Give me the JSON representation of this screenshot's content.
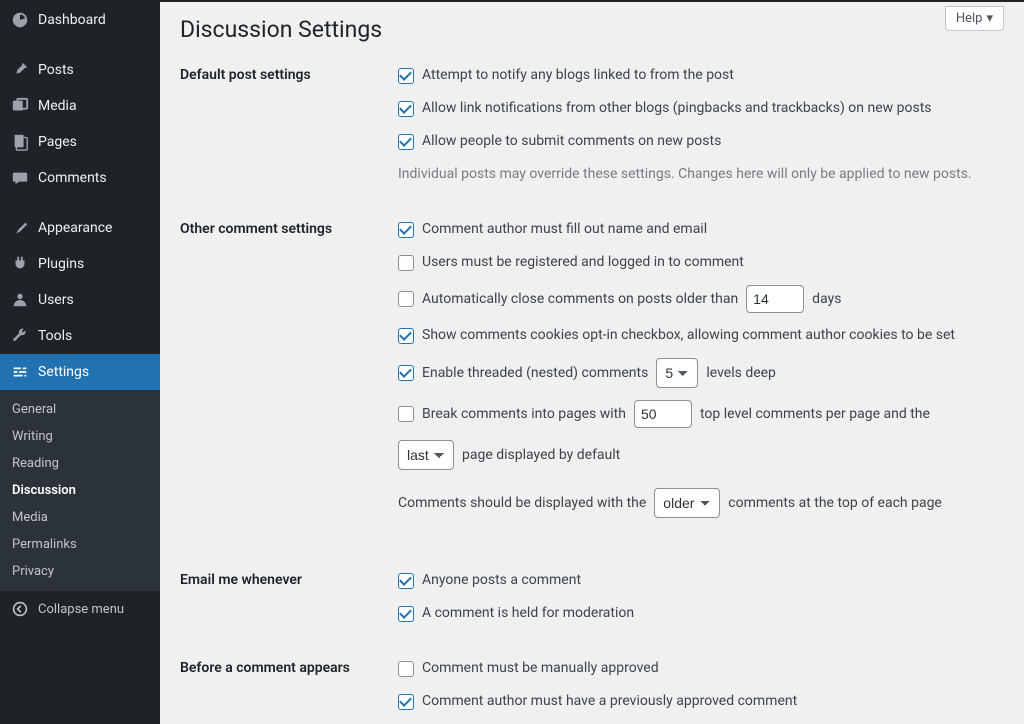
{
  "help_label": "Help",
  "page_title": "Discussion Settings",
  "sidebar": {
    "items": [
      {
        "label": "Dashboard",
        "icon": "dashboard"
      },
      {
        "label": "Posts",
        "icon": "pin"
      },
      {
        "label": "Media",
        "icon": "media"
      },
      {
        "label": "Pages",
        "icon": "page"
      },
      {
        "label": "Comments",
        "icon": "comment"
      },
      {
        "label": "Appearance",
        "icon": "brush"
      },
      {
        "label": "Plugins",
        "icon": "plug"
      },
      {
        "label": "Users",
        "icon": "user"
      },
      {
        "label": "Tools",
        "icon": "wrench"
      },
      {
        "label": "Settings",
        "icon": "sliders"
      }
    ],
    "submenu": [
      "General",
      "Writing",
      "Reading",
      "Discussion",
      "Media",
      "Permalinks",
      "Privacy"
    ],
    "submenu_active": "Discussion",
    "collapse_label": "Collapse menu"
  },
  "sections": {
    "default_post": {
      "heading": "Default post settings",
      "items": [
        {
          "checked": true,
          "label": "Attempt to notify any blogs linked to from the post"
        },
        {
          "checked": true,
          "label": "Allow link notifications from other blogs (pingbacks and trackbacks) on new posts"
        },
        {
          "checked": true,
          "label": "Allow people to submit comments on new posts"
        }
      ],
      "note": "Individual posts may override these settings. Changes here will only be applied to new posts."
    },
    "other_comment": {
      "heading": "Other comment settings",
      "items": {
        "fillout": {
          "checked": true,
          "label": "Comment author must fill out name and email"
        },
        "registered": {
          "checked": false,
          "label": "Users must be registered and logged in to comment"
        },
        "autoclose": {
          "checked": false,
          "prefix": "Automatically close comments on posts older than",
          "value": "14",
          "suffix": "days"
        },
        "cookies": {
          "checked": true,
          "label": "Show comments cookies opt-in checkbox, allowing comment author cookies to be set"
        },
        "threaded": {
          "checked": true,
          "prefix": "Enable threaded (nested) comments",
          "value": "5",
          "suffix": "levels deep"
        },
        "paged": {
          "checked": false,
          "prefix": "Break comments into pages with",
          "value": "50",
          "suffix": "top level comments per page and the"
        },
        "page_order_value": "last",
        "page_order_suffix": "page displayed by default",
        "order_prefix": "Comments should be displayed with the",
        "order_value": "older",
        "order_suffix": "comments at the top of each page"
      }
    },
    "email_me": {
      "heading": "Email me whenever",
      "items": [
        {
          "checked": true,
          "label": "Anyone posts a comment"
        },
        {
          "checked": true,
          "label": "A comment is held for moderation"
        }
      ]
    },
    "before_appears": {
      "heading": "Before a comment appears",
      "items": [
        {
          "checked": false,
          "label": "Comment must be manually approved"
        },
        {
          "checked": true,
          "label": "Comment author must have a previously approved comment"
        }
      ]
    }
  }
}
